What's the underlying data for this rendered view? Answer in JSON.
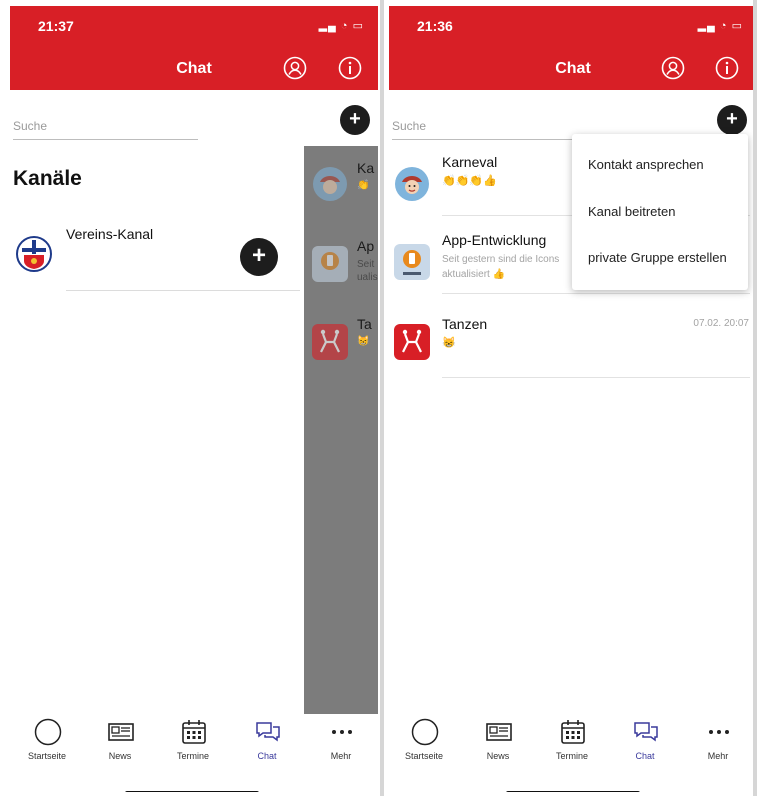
{
  "colors": {
    "brand": "#d81f26",
    "fab": "#1d1d1d",
    "active_tab": "#3a3a9c",
    "drawer_overlay": "#7c7c7c"
  },
  "left": {
    "status_time": "21:37",
    "header_title": "Chat",
    "search_placeholder": "Suche",
    "section_title": "Kanäle",
    "channel": {
      "name": "Vereins-Kanal",
      "icon": "club-crest-icon"
    },
    "drawer_rows": [
      {
        "name": "Ka",
        "preview": "👏"
      },
      {
        "name": "Ap",
        "preview": "Seit\nualis"
      },
      {
        "name": "Ta",
        "preview": "😸"
      }
    ]
  },
  "right": {
    "status_time": "21:36",
    "header_title": "Chat",
    "search_placeholder": "Suche",
    "chats": [
      {
        "name": "Karneval",
        "preview": "👏👏👏👍",
        "time": "",
        "icon": "carnival-icon"
      },
      {
        "name": "App-Entwicklung",
        "preview": "Seit gestern sind die Icons aktualisiert 👍",
        "time": "",
        "icon": "app-project-icon"
      },
      {
        "name": "Tanzen",
        "preview": "😸",
        "time": "07.02. 20:07",
        "icon": "dance-icon"
      }
    ],
    "menu_items": [
      "Kontakt ansprechen",
      "Kanal beitreten",
      "private Gruppe erstellen"
    ]
  },
  "tabs": [
    {
      "label": "Startseite",
      "icon": "home-circle-icon"
    },
    {
      "label": "News",
      "icon": "newspaper-icon"
    },
    {
      "label": "Termine",
      "icon": "calendar-icon"
    },
    {
      "label": "Chat",
      "icon": "chat-bubbles-icon",
      "active": true
    },
    {
      "label": "Mehr",
      "icon": "more-dots-icon"
    }
  ]
}
